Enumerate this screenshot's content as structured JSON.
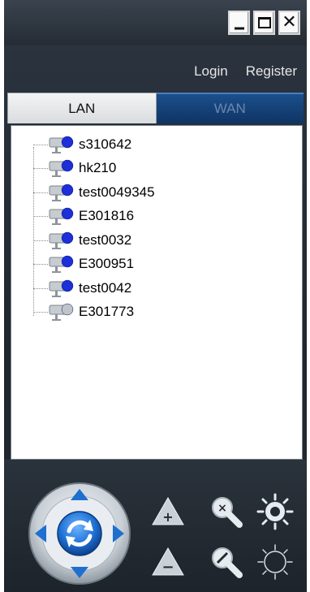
{
  "window": {
    "buttons": {
      "minimize": "_",
      "maximize": "□",
      "close": "✕"
    }
  },
  "header": {
    "login_label": "Login",
    "register_label": "Register"
  },
  "tabs": [
    {
      "label": "LAN",
      "active": true
    },
    {
      "label": "WAN",
      "active": false
    }
  ],
  "devices": [
    {
      "name": "s310642",
      "online": true
    },
    {
      "name": "hk210",
      "online": true
    },
    {
      "name": "test0049345",
      "online": true
    },
    {
      "name": "E301816",
      "online": true
    },
    {
      "name": "test0032",
      "online": true
    },
    {
      "name": "E300951",
      "online": true
    },
    {
      "name": "test0042",
      "online": true
    },
    {
      "name": "E301773",
      "online": false
    }
  ],
  "controls": {
    "ptz_dial": "ptz-direction-dial",
    "buttons": [
      "zoom-in-up",
      "zoom-out-down",
      "focus-near",
      "focus-far",
      "iris-open",
      "iris-close"
    ]
  },
  "colors": {
    "online_dot": "#1c2fd8",
    "accent_blue": "#1e6fd0",
    "background": "#222a32"
  }
}
